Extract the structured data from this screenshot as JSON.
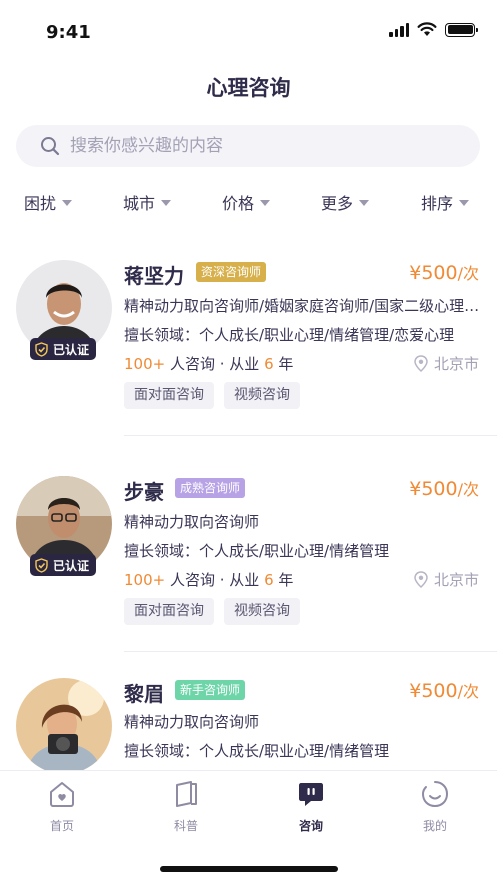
{
  "status_bar": {
    "time": "9:41"
  },
  "header": {
    "title": "心理咨询"
  },
  "search": {
    "placeholder": "搜索你感兴趣的内容"
  },
  "filters": [
    "困扰",
    "城市",
    "价格",
    "更多",
    "排序"
  ],
  "verified_label": "已认证",
  "counselors": [
    {
      "name": "蒋坚力",
      "level": "资深咨询师",
      "level_color": "#d7b04c",
      "price": "¥500",
      "price_unit": "/次",
      "title": "精神动力取向咨询师/婚姻家庭咨询师/国家二级心理咨询师",
      "expertise": "擅长领域：个人成长/职业心理/情绪管理/恋爱心理",
      "consult_count": "100+",
      "consult_label": "人咨询 · 从业",
      "years": "6",
      "years_unit": "年",
      "city": "北京市",
      "modes": [
        "面对面咨询",
        "视频咨询"
      ],
      "verified": true
    },
    {
      "name": "步豪",
      "level": "成熟咨询师",
      "level_color": "#b6a2e4",
      "price": "¥500",
      "price_unit": "/次",
      "title": "精神动力取向咨询师",
      "expertise": "擅长领域：个人成长/职业心理/情绪管理",
      "consult_count": "100+",
      "consult_label": "人咨询 · 从业",
      "years": "6",
      "years_unit": "年",
      "city": "北京市",
      "modes": [
        "面对面咨询",
        "视频咨询"
      ],
      "verified": true
    },
    {
      "name": "黎眉",
      "level": "新手咨询师",
      "level_color": "#6ed5a9",
      "price": "¥500",
      "price_unit": "/次",
      "title": "精神动力取向咨询师",
      "expertise": "擅长领域：个人成长/职业心理/情绪管理",
      "verified": false
    }
  ],
  "tab_bar": {
    "tabs": [
      {
        "label": "首页",
        "icon": "home-icon"
      },
      {
        "label": "科普",
        "icon": "book-icon"
      },
      {
        "label": "咨询",
        "icon": "chat-icon",
        "active": true
      },
      {
        "label": "我的",
        "icon": "profile-icon"
      }
    ]
  }
}
